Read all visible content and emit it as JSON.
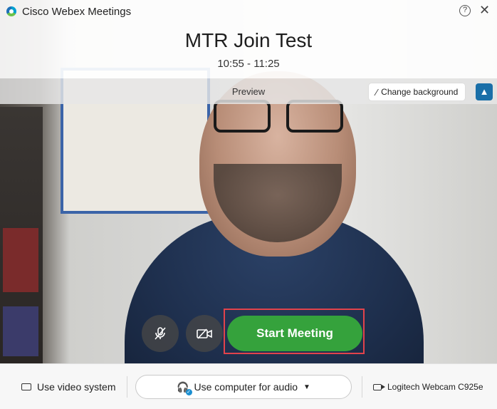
{
  "window": {
    "title": "Cisco Webex Meetings"
  },
  "meeting": {
    "title": "MTR Join Test",
    "time": "10:55 - 11:25"
  },
  "preview": {
    "label": "Preview",
    "change_background": "Change background"
  },
  "controls": {
    "start_meeting": "Start Meeting"
  },
  "bottom": {
    "use_video_system": "Use video system",
    "audio": "Use computer for audio",
    "camera": "Logitech Webcam C925e"
  },
  "colors": {
    "start_button": "#35a23c",
    "highlight": "#e2434b",
    "blur_button": "#1a6fa8"
  }
}
